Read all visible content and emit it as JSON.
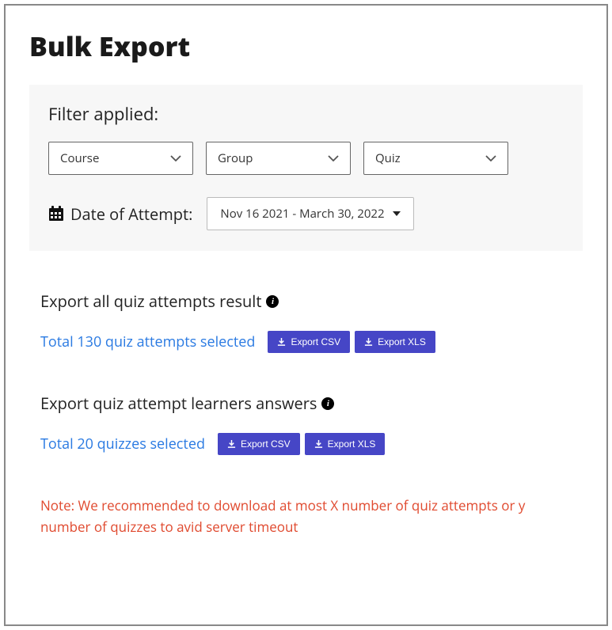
{
  "page_title": "Bulk Export",
  "filter": {
    "heading": "Filter applied:",
    "selects": {
      "course": "Course",
      "group": "Group",
      "quiz": "Quiz"
    },
    "date_label": "Date of Attempt:",
    "date_value": "Nov 16 2021 - March 30, 2022"
  },
  "export_all": {
    "heading": "Export all quiz attempts result",
    "selected_text": "Total 130 quiz attempts selected",
    "btn_csv": "Export CSV",
    "btn_xls": "Export XLS"
  },
  "export_answers": {
    "heading": "Export quiz attempt learners answers",
    "selected_text": "Total 20  quizzes selected",
    "btn_csv": "Export CSV",
    "btn_xls": "Export XLS"
  },
  "note": "Note:  We recommended to download at most  X number of quiz attempts or y number of quizzes to avid server timeout"
}
